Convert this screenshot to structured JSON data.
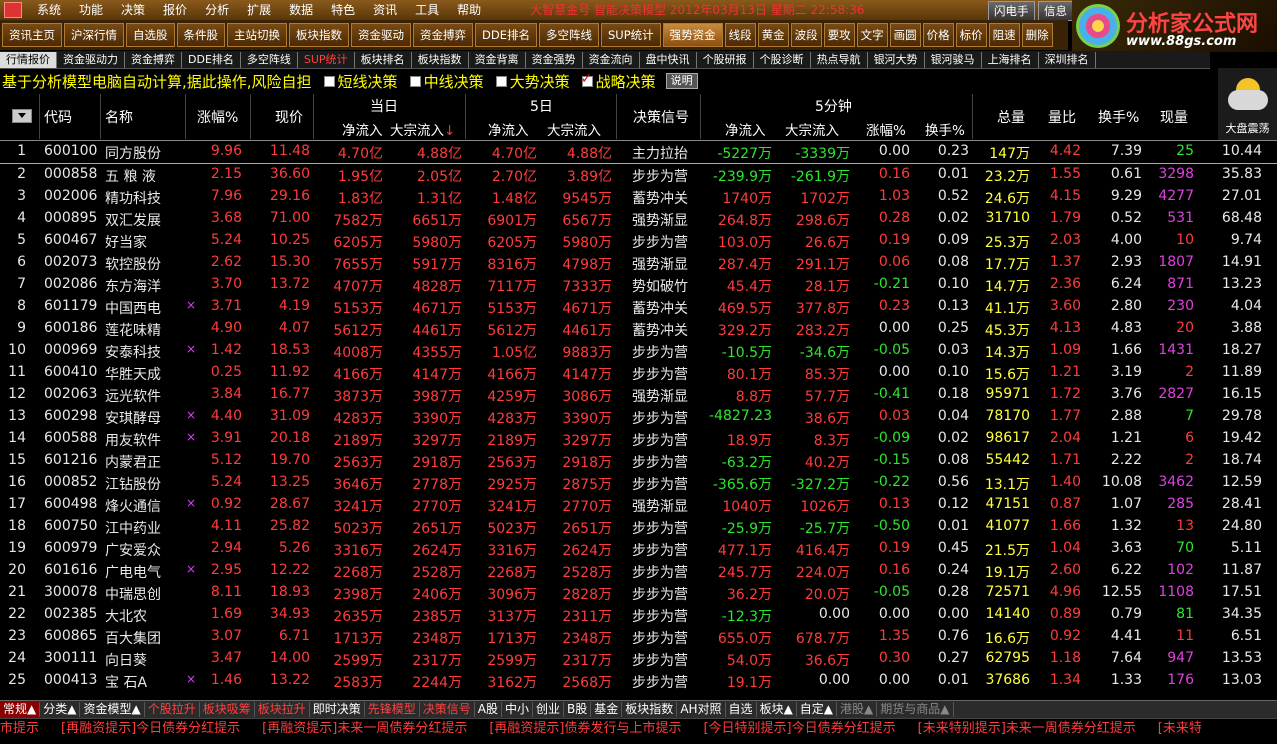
{
  "menu": {
    "items": [
      "系统",
      "功能",
      "决策",
      "报价",
      "分析",
      "扩展",
      "数据",
      "特色",
      "资讯",
      "工具",
      "帮助"
    ],
    "title": "大智慧金号  智能决策模型  2012年03月13日  星期二  22:58:36",
    "right_buttons": [
      "闪电手",
      "信息"
    ]
  },
  "toolbar": [
    "资讯主页",
    "沪深行情",
    "自选股",
    "条件股",
    "主站切换",
    "板块指数",
    "资金驱动",
    "资金搏弈",
    "资金搏弈",
    "多空阵线",
    "DDE排名",
    "多空阵线",
    "SUP统计",
    "强势资金",
    "线段",
    "黄金",
    "波段",
    "要攻",
    "文字",
    "画圆",
    "价格",
    "标价",
    "阻速",
    "删除"
  ],
  "brand": {
    "name": "分析家公式网",
    "url": "www.88gs.com"
  },
  "tabs": [
    "行情报价",
    "资金驱动力",
    "资金搏弈",
    "DDE排名",
    "多空阵线",
    "SUP统计",
    "板块排名",
    "板块指数",
    "资金背离",
    "资金强势",
    "资金流向",
    "盘中快讯",
    "个股研报",
    "个股诊断",
    "热点导航",
    "银河大势",
    "银河骏马",
    "上海排名",
    "深圳排名"
  ],
  "info": {
    "text": "基于分析模型电脑自动计算,据此操作,风险自担",
    "checks": [
      {
        "label": "短线决策",
        "checked": false
      },
      {
        "label": "中线决策",
        "checked": false
      },
      {
        "label": "大势决策",
        "checked": false
      },
      {
        "label": "战略决策",
        "checked": true
      }
    ],
    "explain": "说明"
  },
  "weather": {
    "label": "大盘震荡"
  },
  "headers": {
    "code": "代码",
    "name": "名称",
    "pct": "涨幅%",
    "price": "现价",
    "day": "当日",
    "five": "5日",
    "net": "净流入",
    "big": "大宗流入",
    "signal": "决策信号",
    "fivemin": "5分钟",
    "pct2": "涨幅%",
    "turn": "换手%",
    "vol": "总量",
    "ratio": "量比",
    "turn2": "换手%",
    "cur": "现量"
  },
  "rows": [
    [
      "1",
      "600100",
      "同方股份",
      "",
      "9.96",
      "11.48",
      "4.70亿",
      "4.88亿",
      "4.70亿",
      "4.88亿",
      "主力拉抬",
      "-5227万",
      "-3339万",
      "0.00",
      "0.23",
      "147万",
      "4.42",
      "7.39",
      "25",
      ""
    ],
    [
      "2",
      "000858",
      "五 粮 液",
      "",
      "2.15",
      "36.60",
      "1.95亿",
      "2.05亿",
      "2.70亿",
      "3.89亿",
      "步步为营",
      "-239.9万",
      "-261.9万",
      "0.16",
      "0.01",
      "23.2万",
      "1.55",
      "0.61",
      "3298",
      "35.83"
    ],
    [
      "3",
      "002006",
      "精功科技",
      "",
      "7.96",
      "29.16",
      "1.83亿",
      "1.31亿",
      "1.48亿",
      "9545万",
      "蓄势冲关",
      "1740万",
      "1702万",
      "1.03",
      "0.52",
      "24.6万",
      "4.15",
      "9.29",
      "4277",
      "27.01"
    ],
    [
      "4",
      "000895",
      "双汇发展",
      "",
      "3.68",
      "71.00",
      "7582万",
      "6651万",
      "6901万",
      "6567万",
      "强势渐显",
      "264.8万",
      "298.6万",
      "0.28",
      "0.02",
      "31710",
      "1.79",
      "0.52",
      "531",
      "68.48"
    ],
    [
      "5",
      "600467",
      "好当家",
      "",
      "5.24",
      "10.25",
      "6205万",
      "5980万",
      "6205万",
      "5980万",
      "步步为营",
      "103.0万",
      "26.6万",
      "0.19",
      "0.09",
      "25.3万",
      "2.03",
      "4.00",
      "10",
      "9.74"
    ],
    [
      "6",
      "002073",
      "软控股份",
      "",
      "2.62",
      "15.30",
      "7655万",
      "5917万",
      "8316万",
      "4798万",
      "强势渐显",
      "287.4万",
      "291.1万",
      "0.06",
      "0.08",
      "17.7万",
      "1.37",
      "2.93",
      "1807",
      "14.91"
    ],
    [
      "7",
      "002086",
      "东方海洋",
      "",
      "3.70",
      "13.72",
      "4707万",
      "4828万",
      "7117万",
      "7333万",
      "势如破竹",
      "45.4万",
      "28.1万",
      "-0.21",
      "0.10",
      "14.7万",
      "2.36",
      "6.24",
      "871",
      "13.23"
    ],
    [
      "8",
      "601179",
      "中国西电",
      "×",
      "3.71",
      "4.19",
      "5153万",
      "4671万",
      "5153万",
      "4671万",
      "蓄势冲关",
      "469.5万",
      "377.8万",
      "0.23",
      "0.13",
      "41.1万",
      "3.60",
      "2.80",
      "230",
      "4.04"
    ],
    [
      "9",
      "600186",
      "莲花味精",
      "",
      "4.90",
      "4.07",
      "5612万",
      "4461万",
      "5612万",
      "4461万",
      "蓄势冲关",
      "329.2万",
      "283.2万",
      "0.00",
      "0.25",
      "45.3万",
      "4.13",
      "4.83",
      "20",
      "3.88"
    ],
    [
      "10",
      "000969",
      "安泰科技",
      "×",
      "1.42",
      "18.53",
      "4008万",
      "4355万",
      "1.05亿",
      "9883万",
      "步步为营",
      "-10.5万",
      "-34.6万",
      "-0.05",
      "0.03",
      "14.3万",
      "1.09",
      "1.66",
      "1431",
      "18.27"
    ],
    [
      "11",
      "600410",
      "华胜天成",
      "",
      "0.25",
      "11.92",
      "4166万",
      "4147万",
      "4166万",
      "4147万",
      "步步为营",
      "80.1万",
      "85.3万",
      "0.00",
      "0.10",
      "15.6万",
      "1.21",
      "3.19",
      "2",
      "11.89"
    ],
    [
      "12",
      "002063",
      "远光软件",
      "",
      "3.84",
      "16.77",
      "3873万",
      "3987万",
      "4259万",
      "3086万",
      "强势渐显",
      "8.8万",
      "57.7万",
      "-0.41",
      "0.18",
      "95971",
      "1.72",
      "3.76",
      "2827",
      "16.15"
    ],
    [
      "13",
      "600298",
      "安琪酵母",
      "×",
      "4.40",
      "31.09",
      "4283万",
      "3390万",
      "4283万",
      "3390万",
      "步步为营",
      "-4827.23",
      "38.6万",
      "0.03",
      "0.04",
      "78170",
      "1.77",
      "2.88",
      "7",
      "29.78"
    ],
    [
      "14",
      "600588",
      "用友软件",
      "×",
      "3.91",
      "20.18",
      "2189万",
      "3297万",
      "2189万",
      "3297万",
      "步步为营",
      "18.9万",
      "8.3万",
      "-0.09",
      "0.02",
      "98617",
      "2.04",
      "1.21",
      "6",
      "19.42"
    ],
    [
      "15",
      "601216",
      "内蒙君正",
      "",
      "5.12",
      "19.70",
      "2563万",
      "2918万",
      "2563万",
      "2918万",
      "步步为营",
      "-63.2万",
      "40.2万",
      "-0.15",
      "0.08",
      "55442",
      "1.71",
      "2.22",
      "2",
      "18.74"
    ],
    [
      "16",
      "000852",
      "江钻股份",
      "",
      "5.24",
      "13.25",
      "3646万",
      "2778万",
      "2925万",
      "2875万",
      "步步为营",
      "-365.6万",
      "-327.2万",
      "-0.22",
      "0.56",
      "13.1万",
      "1.40",
      "10.08",
      "3462",
      "12.59"
    ],
    [
      "17",
      "600498",
      "烽火通信",
      "×",
      "0.92",
      "28.67",
      "3241万",
      "2770万",
      "3241万",
      "2770万",
      "强势渐显",
      "1040万",
      "1026万",
      "0.13",
      "0.12",
      "47151",
      "0.87",
      "1.07",
      "285",
      "28.41"
    ],
    [
      "18",
      "600750",
      "江中药业",
      "",
      "4.11",
      "25.82",
      "5023万",
      "2651万",
      "5023万",
      "2651万",
      "步步为营",
      "-25.9万",
      "-25.7万",
      "-0.50",
      "0.01",
      "41077",
      "1.66",
      "1.32",
      "13",
      "24.80"
    ],
    [
      "19",
      "600979",
      "广安爱众",
      "",
      "2.94",
      "5.26",
      "3316万",
      "2624万",
      "3316万",
      "2624万",
      "步步为营",
      "477.1万",
      "416.4万",
      "0.19",
      "0.45",
      "21.5万",
      "1.04",
      "3.63",
      "70",
      "5.11"
    ],
    [
      "20",
      "601616",
      "广电电气",
      "×",
      "2.95",
      "12.22",
      "2268万",
      "2528万",
      "2268万",
      "2528万",
      "步步为营",
      "245.7万",
      "224.0万",
      "0.16",
      "0.24",
      "19.1万",
      "2.60",
      "6.22",
      "102",
      "11.87"
    ],
    [
      "21",
      "300078",
      "中瑞思创",
      "",
      "8.11",
      "18.93",
      "2398万",
      "2406万",
      "3096万",
      "2828万",
      "步步为营",
      "36.2万",
      "20.0万",
      "-0.05",
      "0.28",
      "72571",
      "4.96",
      "12.55",
      "1108",
      "17.51"
    ],
    [
      "22",
      "002385",
      "大北农",
      "",
      "1.69",
      "34.93",
      "2635万",
      "2385万",
      "3137万",
      "2311万",
      "步步为营",
      "-12.3万",
      "0.00",
      "0.00",
      "0.00",
      "14140",
      "0.89",
      "0.79",
      "81",
      "34.35"
    ],
    [
      "23",
      "600865",
      "百大集团",
      "",
      "3.07",
      "6.71",
      "1713万",
      "2348万",
      "1713万",
      "2348万",
      "步步为营",
      "655.0万",
      "678.7万",
      "1.35",
      "0.76",
      "16.6万",
      "0.92",
      "4.41",
      "11",
      "6.51"
    ],
    [
      "24",
      "300111",
      "向日葵",
      "",
      "3.47",
      "14.00",
      "2599万",
      "2317万",
      "2599万",
      "2317万",
      "步步为营",
      "54.0万",
      "36.6万",
      "0.30",
      "0.27",
      "62795",
      "1.18",
      "7.64",
      "947",
      "13.53"
    ],
    [
      "25",
      "000413",
      "宝  石A",
      "×",
      "1.46",
      "13.22",
      "2583万",
      "2244万",
      "3162万",
      "2568万",
      "步步为营",
      "19.1万",
      "0.00",
      "0.00",
      "0.01",
      "37686",
      "1.34",
      "1.33",
      "176",
      "13.03"
    ]
  ],
  "row1_last": "10.44",
  "bottom_tabs": [
    "常规▲",
    "分类▲",
    "资金模型▲",
    "个股拉升",
    "板块吸筹",
    "板块拉升",
    "即时决策",
    "先锋模型",
    "决策信号",
    "A股",
    "中小",
    "创业",
    "B股",
    "基金",
    "板块指数",
    "AH对照",
    "自选",
    "板块▲",
    "自定▲",
    "港股▲",
    "期货与商品▲"
  ],
  "ticker": [
    "市提示",
    "[再融资提示]今日债券分红提示",
    "[再融资提示]未来一周债券分红提示",
    "[再融资提示]债券发行与上市提示",
    "[今日特别提示]今日债券分红提示",
    "[未来特别提示]未来一周债券分红提示",
    "[未来特"
  ]
}
